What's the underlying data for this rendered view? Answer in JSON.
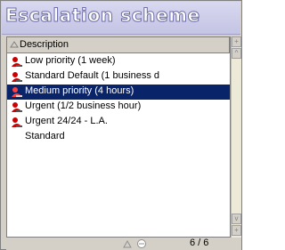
{
  "window": {
    "title": "Escalation scheme"
  },
  "list": {
    "column_header": "Description",
    "rows": [
      {
        "label": "Low priority (1 week)",
        "icon": "priority-icon",
        "selected": false
      },
      {
        "label": "Standard Default (1 business d",
        "icon": "priority-icon",
        "selected": false
      },
      {
        "label": "Medium priority (4 hours)",
        "icon": "priority-icon",
        "selected": true
      },
      {
        "label": "Urgent (1/2 business hour)",
        "icon": "priority-icon",
        "selected": false
      },
      {
        "label": "Urgent 24/24 - L.A.",
        "icon": "priority-icon",
        "selected": false
      },
      {
        "label": "Standard",
        "icon": null,
        "selected": false
      }
    ]
  },
  "footer": {
    "record_count": "6 / 6"
  },
  "colors": {
    "selection": "#0a246a",
    "title_bg": "#c8c8e8",
    "title_outline": "#6c6ca8",
    "panel": "#d4d0c8",
    "icon_red": "#cc0000"
  }
}
